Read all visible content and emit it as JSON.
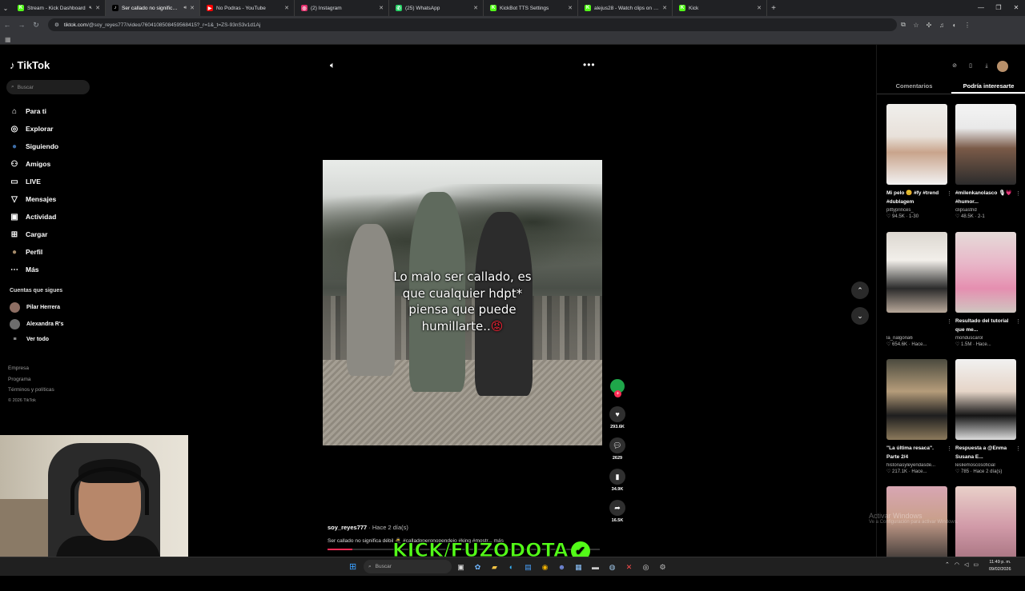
{
  "browser": {
    "tabs": [
      {
        "title": "Stream - Kick Dashboard",
        "fav": "K",
        "fav_color": "#53fc18",
        "muted": true
      },
      {
        "title": "Ser callado no significa se",
        "fav": "♪",
        "fav_color": "#000000",
        "active": true,
        "sound": true
      },
      {
        "title": "No Podras - YouTube",
        "fav": "▶",
        "fav_color": "#ff0000"
      },
      {
        "title": "(2) Instagram",
        "fav": "◎",
        "fav_color": "#e1306c"
      },
      {
        "title": "(25) WhatsApp",
        "fav": "✆",
        "fav_color": "#25d366"
      },
      {
        "title": "KickBot TTS Settings",
        "fav": "K",
        "fav_color": "#53fc18"
      },
      {
        "title": "alejus28 - Watch clips on Kick",
        "fav": "K",
        "fav_color": "#53fc18"
      },
      {
        "title": "Kick",
        "fav": "K",
        "fav_color": "#53fc18"
      }
    ],
    "url_host": "tiktok.com",
    "url_path": "/@soy_reyes777/video/7604108508459568415?_r=1&_t=ZS-93nS3v1d1Aj"
  },
  "tiktok": {
    "logo": "TikTok",
    "search_placeholder": "Buscar",
    "nav": [
      {
        "label": "Para ti",
        "icon": "home-icon",
        "glyph": "⌂"
      },
      {
        "label": "Explorar",
        "icon": "compass-icon",
        "glyph": "◎"
      },
      {
        "label": "Siguiendo",
        "icon": "following-avatar-icon",
        "glyph": "●"
      },
      {
        "label": "Amigos",
        "icon": "friends-icon",
        "glyph": "⚇"
      },
      {
        "label": "LIVE",
        "icon": "live-icon",
        "glyph": "▭"
      },
      {
        "label": "Mensajes",
        "icon": "paper-plane-icon",
        "glyph": "▽"
      },
      {
        "label": "Actividad",
        "icon": "activity-icon",
        "glyph": "▣"
      },
      {
        "label": "Cargar",
        "icon": "upload-icon",
        "glyph": "⊞"
      },
      {
        "label": "Perfil",
        "icon": "profile-avatar-icon",
        "glyph": "●"
      },
      {
        "label": "Más",
        "icon": "more-dots-icon",
        "glyph": "⋯"
      }
    ],
    "following_title": "Cuentas que sigues",
    "following": [
      {
        "name": "Pilar Herrera"
      },
      {
        "name": "Alexandra R's"
      },
      {
        "name": "Ver todo"
      }
    ],
    "footer": [
      "Empresa",
      "Programa",
      "Términos y políticas",
      "© 2026 TikTok"
    ],
    "video": {
      "caption_lines": [
        "Lo malo ser callado, es",
        "que cualquier hdpt*",
        "piensa que puede",
        "humillarte.."
      ],
      "caption_emoji": "😡",
      "likes": "293.6K",
      "comments": "2629",
      "saves": "34.9K",
      "shares": "16.5K",
      "author": "soy_reyes777",
      "posted": " · Hace 2 día(s)",
      "description": "Ser callado no significa débil 🥷 #calladoperonopendejo #king #mostr... más",
      "progress": 0.09
    },
    "right_tabs": [
      "Comentarios",
      "Podría interesarte"
    ],
    "cards": [
      {
        "title": "Mi pelo 😊 #fy #trend #dublagem",
        "user": "pittyprinces_",
        "stats": "♡ 94.5K · 1-30",
        "bg": "linear-gradient(180deg,#f0efec 0%,#e8e1da 40%,#c9a48c 60%,#f3f3f3 100%)"
      },
      {
        "title": "#milenkanolasco 🎙💗 #humor...",
        "user": "clipsastrid",
        "stats": "♡ 48.5K · 2-1",
        "bg": "linear-gradient(180deg,#f4f4f4 0%,#e9e9e9 30%,#7a5a48 55%,#2c2c2c 100%)"
      },
      {
        "title": "",
        "user": "la_nalgona6",
        "stats": "♡ 654.6K · Hace...",
        "bg": "linear-gradient(180deg,#dcd7d0 0%,#f2efea 35%,#2b2b2b 70%,#b8a89a 100%)"
      },
      {
        "title": "Resultado del tutorial que me...",
        "user": "monduscarol",
        "stats": "♡ 1.5M · Hace...",
        "bg": "linear-gradient(180deg,#e6dbd9 0%,#e8b6c8 40%,#e58fb0 70%,#cfc6c0 100%)"
      },
      {
        "title": "\"La última resaca\". Parte 2/4",
        "user": "historiasyleyendasde...",
        "stats": "♡ 217.1K · Hace...",
        "bg": "linear-gradient(180deg,#4b4a3e 0%,#b59c7a 40%,#1e1e1e 70%,#8c7a5c 100%)"
      },
      {
        "title": "Respuesta a @Enma Susana E...",
        "user": "lesliemoscosoficial",
        "stats": "♡ 785 · Hace 2 día(s)",
        "bg": "linear-gradient(180deg,#f1f1f1 0%,#e6d5c8 40%,#151515 70%,#ddd 100%)"
      },
      {
        "title": "",
        "user": "",
        "stats": "",
        "bg": "linear-gradient(180deg,#d8a6b3 0%,#caa08d 40%,#2a2a2a 100%)"
      },
      {
        "title": "",
        "user": "",
        "stats": "",
        "bg": "linear-gradient(180deg,#e9d0c9 0%,#d19aa8 50%,#a06d7a 100%)"
      }
    ],
    "activate_windows": "Activar Windows",
    "activate_windows_sub": "Ve a Configuración para activar Windows."
  },
  "overlay": {
    "kick_text": "KICK/FUZODOTA",
    "check": "✔"
  },
  "taskbar": {
    "search_placeholder": "Buscar",
    "time": "11:49 p. m.",
    "date": "09/02/2026"
  }
}
